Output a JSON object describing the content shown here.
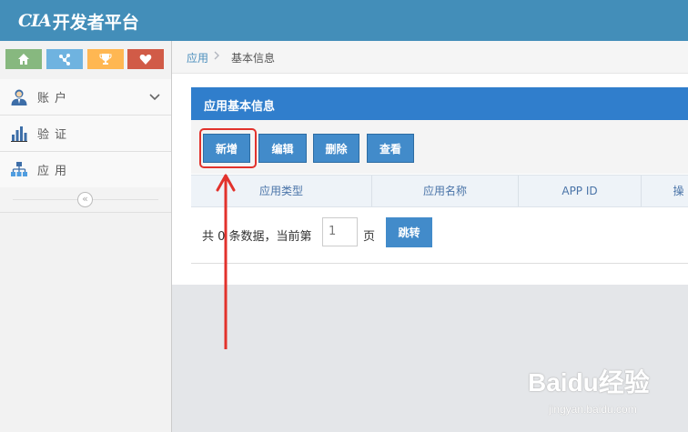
{
  "header": {
    "logo_mark": "CIA",
    "title": "开发者平台"
  },
  "sidebar": {
    "shortcuts": [
      {
        "icon": "home-icon",
        "color": "#87b87f"
      },
      {
        "icon": "network-icon",
        "color": "#6fb3e0"
      },
      {
        "icon": "trophy-icon",
        "color": "#ffb752"
      },
      {
        "icon": "heart-icon",
        "color": "#d15b47"
      }
    ],
    "items": [
      {
        "label": "账户",
        "icon": "user-icon",
        "expandable": true
      },
      {
        "label": "验证",
        "icon": "bar-chart-icon"
      },
      {
        "label": "应用",
        "icon": "sitemap-icon"
      }
    ],
    "collapse_glyph": "«"
  },
  "breadcrumb": {
    "link": "应用",
    "current": "基本信息"
  },
  "panel": {
    "title": "应用基本信息",
    "buttons": {
      "add": "新增",
      "edit": "编辑",
      "delete": "删除",
      "view": "查看"
    },
    "table": {
      "columns": [
        "应用类型",
        "应用名称",
        "APP ID",
        "操"
      ]
    },
    "pager": {
      "prefix": "共 0 条数据，当前第",
      "page_value": "1",
      "suffix": "页",
      "go": "跳转"
    }
  },
  "annotation": {
    "color": "#e2322c"
  },
  "watermark": {
    "brand": "Baidu经验",
    "url": "jingyan.baidu.com"
  }
}
